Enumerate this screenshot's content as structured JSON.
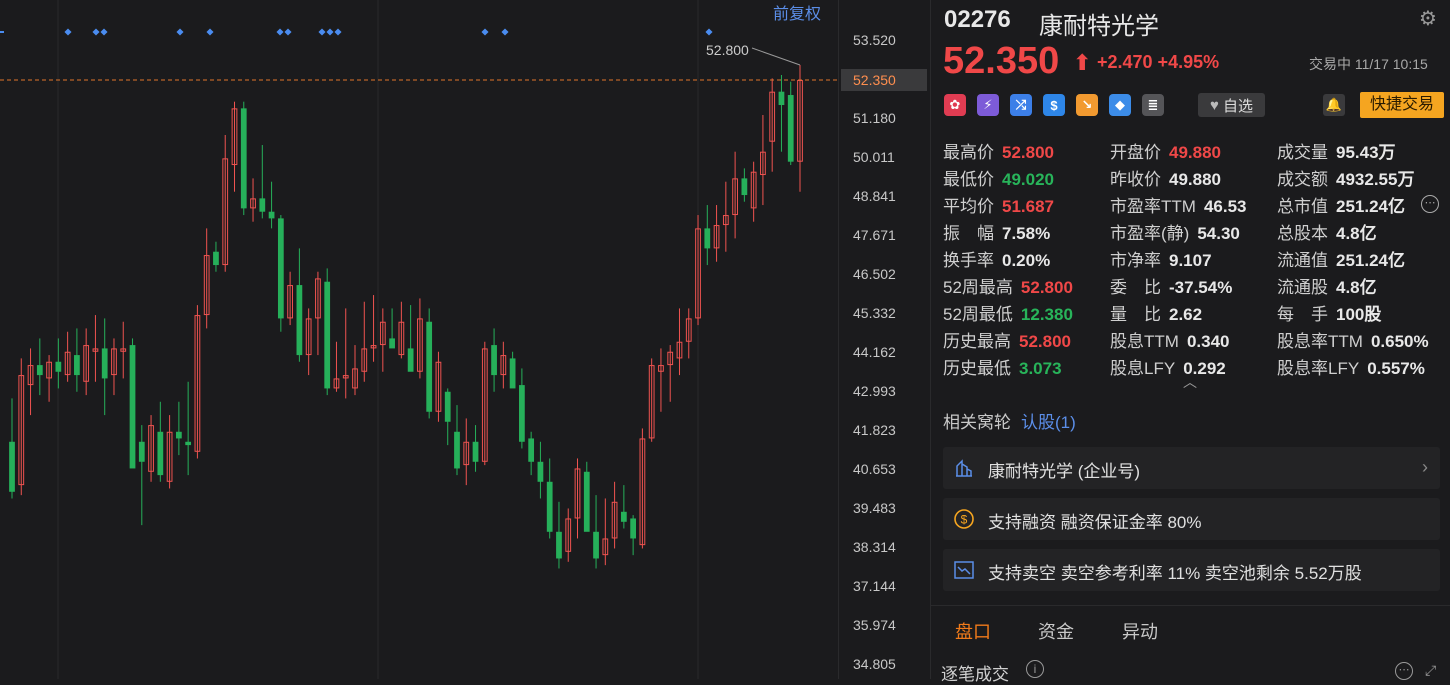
{
  "chart": {
    "adjust_label": "前复权",
    "tools": [
      "↶",
      "−",
      "+"
    ],
    "price_ticks": [
      "53.520",
      "52.350",
      "51.180",
      "50.011",
      "48.841",
      "47.671",
      "46.502",
      "45.332",
      "44.162",
      "42.993",
      "41.823",
      "40.653",
      "39.483",
      "38.314",
      "37.144",
      "35.974",
      "34.805"
    ],
    "current_price_tag": "52.350",
    "high_label": "52.800",
    "colors": {
      "up": "#ef5350",
      "down": "#26b05a",
      "dash": "#e0752a",
      "marker": "#4a8cf0"
    }
  },
  "chart_data": {
    "type": "candlestick",
    "ylim": [
      34.805,
      53.52
    ],
    "current_price": 52.35,
    "high_marker": 52.8,
    "candles": [
      [
        41.5,
        42.8,
        39.8,
        40.0
      ],
      [
        40.2,
        44.0,
        39.9,
        43.5
      ],
      [
        43.2,
        44.3,
        42.3,
        43.8
      ],
      [
        43.8,
        44.6,
        42.9,
        43.5
      ],
      [
        43.4,
        44.1,
        42.7,
        43.9
      ],
      [
        43.9,
        44.6,
        43.1,
        43.6
      ],
      [
        43.5,
        44.8,
        43.3,
        44.2
      ],
      [
        44.1,
        44.9,
        43.0,
        43.5
      ],
      [
        43.3,
        44.9,
        42.9,
        44.4
      ],
      [
        44.2,
        45.3,
        43.3,
        44.3
      ],
      [
        44.3,
        45.2,
        42.3,
        43.4
      ],
      [
        43.5,
        44.6,
        42.9,
        44.3
      ],
      [
        44.2,
        45.1,
        43.4,
        44.3
      ],
      [
        44.4,
        44.6,
        41.4,
        40.7
      ],
      [
        41.5,
        42.0,
        39.0,
        40.9
      ],
      [
        40.6,
        42.3,
        40.3,
        42.0
      ],
      [
        41.8,
        42.7,
        40.3,
        40.5
      ],
      [
        40.3,
        42.3,
        40.1,
        41.8
      ],
      [
        41.8,
        42.7,
        41.1,
        41.6
      ],
      [
        41.5,
        43.3,
        40.5,
        41.4
      ],
      [
        41.2,
        45.6,
        41.0,
        45.3
      ],
      [
        45.3,
        47.9,
        44.9,
        47.1
      ],
      [
        47.2,
        47.5,
        46.6,
        46.8
      ],
      [
        46.8,
        50.7,
        46.6,
        50.0
      ],
      [
        49.8,
        51.7,
        49.0,
        51.5
      ],
      [
        51.5,
        51.7,
        48.3,
        48.5
      ],
      [
        48.5,
        49.4,
        48.1,
        48.8
      ],
      [
        48.8,
        50.4,
        48.2,
        48.4
      ],
      [
        48.4,
        49.3,
        47.9,
        48.2
      ],
      [
        48.2,
        48.3,
        44.8,
        45.2
      ],
      [
        45.2,
        46.6,
        45.0,
        46.2
      ],
      [
        46.2,
        47.3,
        43.9,
        44.1
      ],
      [
        44.1,
        45.5,
        43.5,
        45.2
      ],
      [
        45.2,
        46.6,
        44.1,
        46.4
      ],
      [
        46.3,
        46.7,
        42.9,
        43.1
      ],
      [
        43.1,
        44.5,
        43.0,
        43.4
      ],
      [
        43.4,
        45.5,
        42.8,
        43.5
      ],
      [
        43.1,
        44.4,
        42.9,
        43.7
      ],
      [
        43.6,
        45.7,
        43.3,
        44.3
      ],
      [
        44.3,
        45.9,
        43.9,
        44.4
      ],
      [
        44.4,
        45.5,
        43.6,
        45.1
      ],
      [
        44.6,
        45.5,
        44.4,
        44.3
      ],
      [
        44.1,
        45.7,
        44.0,
        45.1
      ],
      [
        44.3,
        45.6,
        44.0,
        43.6
      ],
      [
        43.6,
        45.8,
        43.4,
        45.2
      ],
      [
        45.1,
        45.5,
        42.2,
        42.4
      ],
      [
        42.4,
        44.2,
        42.1,
        43.9
      ],
      [
        43.0,
        43.1,
        41.4,
        42.1
      ],
      [
        41.8,
        42.6,
        40.5,
        40.7
      ],
      [
        40.8,
        42.2,
        40.2,
        41.5
      ],
      [
        41.5,
        42.0,
        40.6,
        40.9
      ],
      [
        40.9,
        44.5,
        40.8,
        44.3
      ],
      [
        44.4,
        44.9,
        43.0,
        43.5
      ],
      [
        43.5,
        44.5,
        43.1,
        44.1
      ],
      [
        44.0,
        44.2,
        43.3,
        43.1
      ],
      [
        43.2,
        43.7,
        41.3,
        41.5
      ],
      [
        41.6,
        41.8,
        40.5,
        40.9
      ],
      [
        40.9,
        41.5,
        39.8,
        40.3
      ],
      [
        40.3,
        41.0,
        38.6,
        38.8
      ],
      [
        38.8,
        39.7,
        37.7,
        38.0
      ],
      [
        38.2,
        39.5,
        37.9,
        39.2
      ],
      [
        39.2,
        41.0,
        38.6,
        40.7
      ],
      [
        40.6,
        40.9,
        38.9,
        38.8
      ],
      [
        38.8,
        39.9,
        37.7,
        38.0
      ],
      [
        38.1,
        39.8,
        37.8,
        38.6
      ],
      [
        38.6,
        40.3,
        38.3,
        39.7
      ],
      [
        39.4,
        40.2,
        38.9,
        39.1
      ],
      [
        39.2,
        39.3,
        38.1,
        38.6
      ],
      [
        38.4,
        41.9,
        38.3,
        41.6
      ],
      [
        41.6,
        44.0,
        41.5,
        43.8
      ],
      [
        43.6,
        44.3,
        42.4,
        43.8
      ],
      [
        43.8,
        44.4,
        42.7,
        44.2
      ],
      [
        44.0,
        45.5,
        43.5,
        44.5
      ],
      [
        44.5,
        45.5,
        44.0,
        45.2
      ],
      [
        45.2,
        48.3,
        45.0,
        47.9
      ],
      [
        47.9,
        48.6,
        46.8,
        47.3
      ],
      [
        47.3,
        48.6,
        46.9,
        48.0
      ],
      [
        48.0,
        49.3,
        47.2,
        48.3
      ],
      [
        48.3,
        50.2,
        47.6,
        49.4
      ],
      [
        49.4,
        49.7,
        48.7,
        48.9
      ],
      [
        48.5,
        49.9,
        48.1,
        49.6
      ],
      [
        49.5,
        51.3,
        48.6,
        50.2
      ],
      [
        50.5,
        52.4,
        49.6,
        52.0
      ],
      [
        52.0,
        52.5,
        50.2,
        51.6
      ],
      [
        51.9,
        52.3,
        49.8,
        49.9
      ],
      [
        49.9,
        52.8,
        49.0,
        52.35
      ]
    ],
    "marker_counts": [
      1,
      2,
      1,
      1,
      2,
      3,
      1,
      1,
      1
    ]
  },
  "header": {
    "code": "02276",
    "name": "康耐特光学",
    "price": "52.350",
    "arrow": "⬆",
    "change": "+2.470 +4.95%",
    "status": "交易中 11/17 10:15"
  },
  "toolbar": {
    "icons": [
      {
        "name": "hk-flag-icon",
        "glyph": "✿",
        "color": "#e03c52"
      },
      {
        "name": "lightning-icon",
        "glyph": "⚡",
        "color": "#7d5bd8"
      },
      {
        "name": "shuffle-icon",
        "glyph": "⤮",
        "color": "#3c7fe8"
      },
      {
        "name": "dollar-icon",
        "glyph": "$",
        "color": "#2e86e8"
      },
      {
        "name": "trend-down-icon",
        "glyph": "↘",
        "color": "#f29a30"
      },
      {
        "name": "tag-icon",
        "glyph": "◆",
        "color": "#3c8ce8"
      },
      {
        "name": "note-icon",
        "glyph": "≣",
        "color": "#555558"
      }
    ],
    "watch_label": "自选",
    "quick_trade_label": "快捷交易"
  },
  "stats": [
    [
      {
        "label": "最高价",
        "value": "52.800",
        "color": "red"
      },
      {
        "label": "开盘价",
        "value": "49.880",
        "color": "red"
      },
      {
        "label": "成交量",
        "value": "95.43万",
        "color": ""
      }
    ],
    [
      {
        "label": "最低价",
        "value": "49.020",
        "color": "green"
      },
      {
        "label": "昨收价",
        "value": "49.880",
        "color": ""
      },
      {
        "label": "成交额",
        "value": "4932.55万",
        "color": ""
      }
    ],
    [
      {
        "label": "平均价",
        "value": "51.687",
        "color": "red"
      },
      {
        "label": "市盈率TTM",
        "value": "46.53",
        "color": ""
      },
      {
        "label": "总市值",
        "value": "251.24亿",
        "color": ""
      }
    ],
    [
      {
        "label": "振　幅",
        "value": "7.58%",
        "color": ""
      },
      {
        "label": "市盈率(静)",
        "value": "54.30",
        "color": ""
      },
      {
        "label": "总股本",
        "value": "4.8亿",
        "color": ""
      }
    ],
    [
      {
        "label": "换手率",
        "value": "0.20%",
        "color": ""
      },
      {
        "label": "市净率",
        "value": "9.107",
        "color": ""
      },
      {
        "label": "流通值",
        "value": "251.24亿",
        "color": ""
      }
    ],
    [
      {
        "label": "52周最高",
        "value": "52.800",
        "color": "red"
      },
      {
        "label": "委　比",
        "value": "-37.54%",
        "color": ""
      },
      {
        "label": "流通股",
        "value": "4.8亿",
        "color": ""
      }
    ],
    [
      {
        "label": "52周最低",
        "value": "12.380",
        "color": "green"
      },
      {
        "label": "量　比",
        "value": "2.62",
        "color": ""
      },
      {
        "label": "每　手",
        "value": "100股",
        "color": ""
      }
    ],
    [
      {
        "label": "历史最高",
        "value": "52.800",
        "color": "red"
      },
      {
        "label": "股息TTM",
        "value": "0.340",
        "color": ""
      },
      {
        "label": "股息率TTM",
        "value": "0.650%",
        "color": ""
      }
    ],
    [
      {
        "label": "历史最低",
        "value": "3.073",
        "color": "green"
      },
      {
        "label": "股息LFY",
        "value": "0.292",
        "color": ""
      },
      {
        "label": "股息率LFY",
        "value": "0.557%",
        "color": ""
      }
    ]
  ],
  "warrants": {
    "label": "相关窝轮",
    "link": "认股(1)"
  },
  "cards": [
    {
      "text": "康耐特光学 (企业号)",
      "icon": "building-icon",
      "chevron": "›"
    },
    {
      "text": "支持融资 融资保证金率 80%",
      "icon": "coin-icon",
      "chevron": ""
    },
    {
      "text": "支持卖空 卖空参考利率 11% 卖空池剩余 5.52万股",
      "icon": "short-sell-icon",
      "chevron": ""
    }
  ],
  "tabs": [
    {
      "label": "盘口"
    },
    {
      "label": "资金"
    },
    {
      "label": "异动"
    }
  ],
  "bottom": {
    "section_label": "逐笔成交"
  }
}
